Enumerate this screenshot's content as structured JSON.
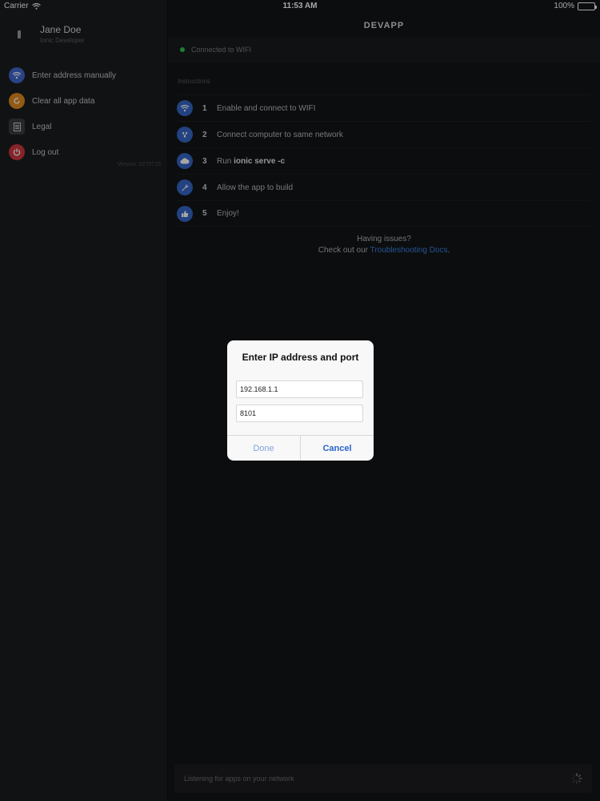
{
  "status_bar": {
    "carrier": "Carrier",
    "time": "11:53 AM",
    "battery": "100%"
  },
  "sidebar": {
    "profile": {
      "name": "Jane Doe",
      "role": "Ionic Developer"
    },
    "items": [
      {
        "label": "Enter address manually",
        "icon": "wifi-icon",
        "color": "#3f67cc"
      },
      {
        "label": "Clear all app data",
        "icon": "refresh-icon",
        "color": "#e08a1e"
      },
      {
        "label": "Legal",
        "icon": "document-icon",
        "color": "#3a3c41"
      },
      {
        "label": "Log out",
        "icon": "logout-icon",
        "color": "#d0383f"
      }
    ],
    "version": "Version: 0275715"
  },
  "header": {
    "title": "DEVAPP"
  },
  "connection": {
    "text": "Connected to WIFI",
    "status_color": "#2fc255"
  },
  "instructions": {
    "label": "Instructions",
    "steps": [
      {
        "num": "1",
        "text": "Enable and connect to WIFI",
        "icon": "wifi-icon"
      },
      {
        "num": "2",
        "text_prefix": "Connect computer to same network",
        "icon": "network-icon"
      },
      {
        "num": "3",
        "text_prefix": "Run ",
        "text_bold": "ionic serve -c",
        "icon": "cloud-icon"
      },
      {
        "num": "4",
        "text": "Allow the app to build",
        "icon": "wrench-icon"
      },
      {
        "num": "5",
        "text": "Enjoy!",
        "icon": "thumbs-up-icon"
      }
    ]
  },
  "help": {
    "line1": "Having issues?",
    "line2_prefix": "Check out our ",
    "link": "Troubleshooting Docs",
    "line2_suffix": "."
  },
  "footer": {
    "text": "Listening for apps on your network"
  },
  "dialog": {
    "title": "Enter IP address and port",
    "ip_value": "192.168.1.1",
    "port_value": "8101",
    "done_label": "Done",
    "cancel_label": "Cancel"
  }
}
